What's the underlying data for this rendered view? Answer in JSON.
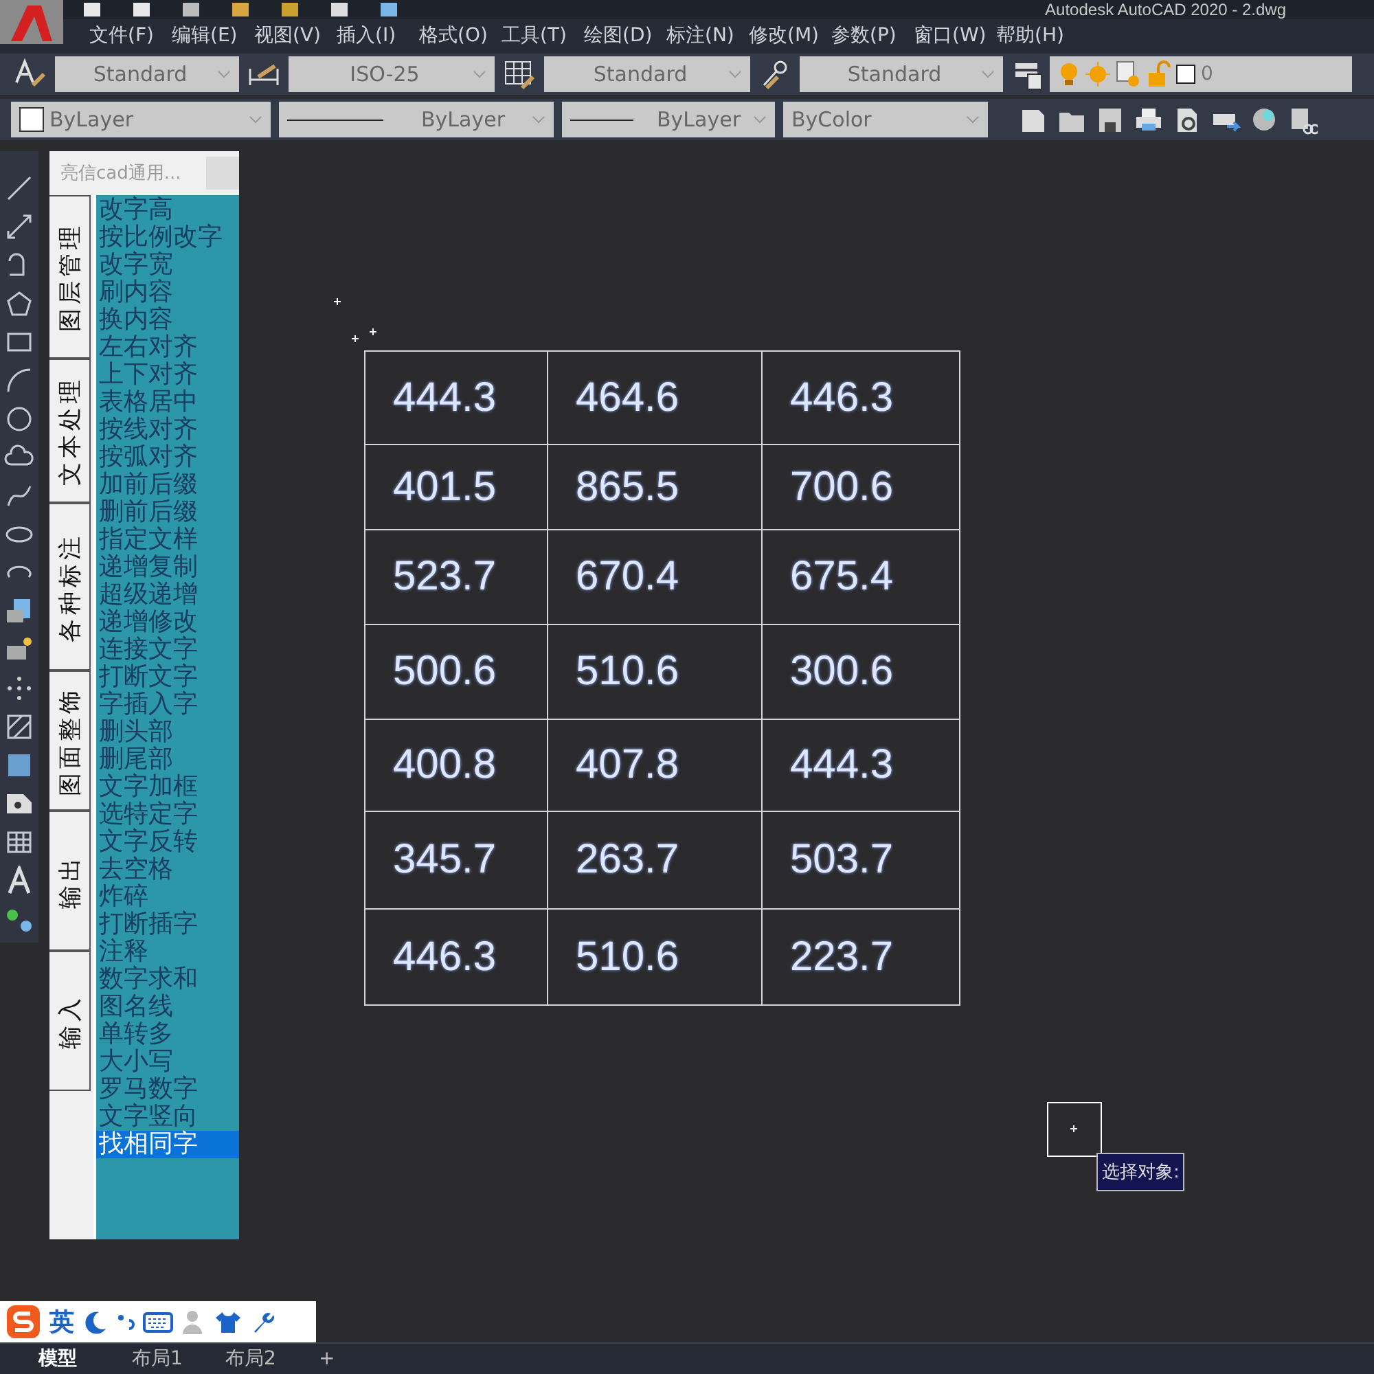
{
  "window": {
    "title": "Autodesk AutoCAD 2020 - 2.dwg"
  },
  "menu": [
    "文件(F)",
    "编辑(E)",
    "视图(V)",
    "插入(I)",
    "格式(O)",
    "工具(T)",
    "绘图(D)",
    "标注(N)",
    "修改(M)",
    "参数(P)",
    "窗口(W)",
    "帮助(H)"
  ],
  "styles_toolbar": {
    "dropdowns": [
      {
        "kind": "text",
        "value": "Standard"
      },
      {
        "kind": "dimension",
        "value": "ISO-25"
      },
      {
        "kind": "table",
        "value": "Standard"
      },
      {
        "kind": "multileader",
        "value": "Standard"
      }
    ],
    "layer": "0"
  },
  "properties_toolbar": {
    "dropdowns": [
      {
        "kind": "color",
        "value": "ByLayer"
      },
      {
        "kind": "linetype",
        "value": "ByLayer"
      },
      {
        "kind": "lineweight",
        "value": "ByLayer"
      },
      {
        "kind": "plain",
        "value": "ByColor"
      }
    ]
  },
  "palette": {
    "title": "亮信cad通用...",
    "tabs": [
      "图层管理",
      "文本处理",
      "各种标注",
      "图面整饰",
      "输出",
      "输入"
    ],
    "items": [
      {
        "label": "改字高",
        "selected": false
      },
      {
        "label": "按比例改字",
        "selected": false
      },
      {
        "label": "改字宽",
        "selected": false
      },
      {
        "label": "刷内容",
        "selected": false
      },
      {
        "label": "换内容",
        "selected": false
      },
      {
        "label": "左右对齐",
        "selected": false
      },
      {
        "label": "上下对齐",
        "selected": false
      },
      {
        "label": "表格居中",
        "selected": false
      },
      {
        "label": "按线对齐",
        "selected": false
      },
      {
        "label": "按弧对齐",
        "selected": false
      },
      {
        "label": "加前后缀",
        "selected": false
      },
      {
        "label": "删前后缀",
        "selected": false
      },
      {
        "label": "指定文样",
        "selected": false
      },
      {
        "label": "递增复制",
        "selected": false
      },
      {
        "label": "超级递增",
        "selected": false
      },
      {
        "label": "递增修改",
        "selected": false
      },
      {
        "label": "连接文字",
        "selected": false
      },
      {
        "label": "打断文字",
        "selected": false
      },
      {
        "label": "字插入字",
        "selected": false
      },
      {
        "label": "删头部",
        "selected": false
      },
      {
        "label": "删尾部",
        "selected": false
      },
      {
        "label": "文字加框",
        "selected": false
      },
      {
        "label": "选特定字",
        "selected": false
      },
      {
        "label": "文字反转",
        "selected": false
      },
      {
        "label": "去空格",
        "selected": false
      },
      {
        "label": "炸碎",
        "selected": false
      },
      {
        "label": "打断插字",
        "selected": false
      },
      {
        "label": "注释",
        "selected": false
      },
      {
        "label": "数字求和",
        "selected": false
      },
      {
        "label": "图名线",
        "selected": false
      },
      {
        "label": "单转多",
        "selected": false
      },
      {
        "label": "大小写",
        "selected": false
      },
      {
        "label": "罗马数字",
        "selected": false
      },
      {
        "label": "文字竖向",
        "selected": false
      },
      {
        "label": "找相同字",
        "selected": true
      }
    ]
  },
  "drawing_table": {
    "rows": [
      [
        "444.3",
        "464.6",
        "446.3"
      ],
      [
        "401.5",
        "865.5",
        "700.6"
      ],
      [
        "523.7",
        "670.4",
        "675.4"
      ],
      [
        "500.6",
        "510.6",
        "300.6"
      ],
      [
        "400.8",
        "407.8",
        "444.3"
      ],
      [
        "345.7",
        "263.7",
        "503.7"
      ],
      [
        "446.3",
        "510.6",
        "223.7"
      ]
    ]
  },
  "tooltip": "选择对象:",
  "ime_bar": {
    "mode": "英"
  },
  "layout_tabs": [
    {
      "label": "模型",
      "selected": true
    },
    {
      "label": "布局1",
      "selected": false
    },
    {
      "label": "布局2",
      "selected": false
    },
    {
      "label": "+",
      "selected": false
    }
  ]
}
